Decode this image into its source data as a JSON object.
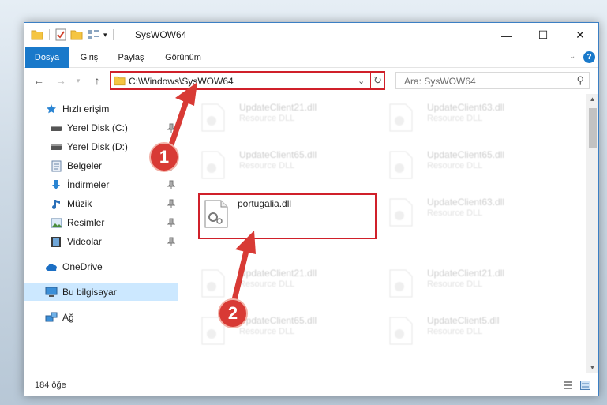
{
  "window": {
    "title": "SysWOW64",
    "minimize_glyph": "—",
    "maximize_glyph": "☐",
    "close_glyph": "✕"
  },
  "ribbon": {
    "tabs": [
      "Dosya",
      "Giriş",
      "Paylaş",
      "Görünüm"
    ]
  },
  "address": {
    "path": "C:\\Windows\\SysWOW64",
    "search_placeholder": "Ara: SysWOW64"
  },
  "nav": {
    "items": [
      {
        "label": "Hızlı erişim",
        "icon": "star-icon",
        "pinned": false
      },
      {
        "label": "Yerel Disk (C:)",
        "icon": "drive-icon",
        "pinned": true
      },
      {
        "label": "Yerel Disk (D:)",
        "icon": "drive-icon",
        "pinned": true
      },
      {
        "label": "Belgeler",
        "icon": "documents-icon",
        "pinned": true
      },
      {
        "label": "İndirmeler",
        "icon": "download-icon",
        "pinned": true
      },
      {
        "label": "Müzik",
        "icon": "music-icon",
        "pinned": true
      },
      {
        "label": "Resimler",
        "icon": "pictures-icon",
        "pinned": true
      },
      {
        "label": "Videolar",
        "icon": "video-icon",
        "pinned": true
      },
      {
        "label": "OneDrive",
        "icon": "cloud-icon",
        "pinned": false
      },
      {
        "label": "Bu bilgisayar",
        "icon": "computer-icon",
        "pinned": false,
        "selected": true
      },
      {
        "label": "Ağ",
        "icon": "network-icon",
        "pinned": false
      }
    ]
  },
  "files": {
    "focused": {
      "name": "portugalia.dll"
    },
    "background": [
      {
        "name": "UpdateClient21.dll",
        "type": "Resource DLL"
      },
      {
        "name": "UpdateClient63.dll",
        "type": "Resource DLL"
      },
      {
        "name": "UpdateClient65.dll",
        "type": "Resource DLL"
      },
      {
        "name": "UpdateClient65.dll",
        "type": "Resource DLL"
      },
      {
        "name": "UpdateClient63.dll",
        "type": "Resource DLL"
      },
      {
        "name": "UpdateClient21.dll",
        "type": "Resource DLL"
      },
      {
        "name": "UpdateClient21.dll",
        "type": "Resource DLL"
      },
      {
        "name": "UpdateClient65.dll",
        "type": "Resource DLL"
      },
      {
        "name": "UpdateClient5.dll",
        "type": "Resource DLL"
      }
    ]
  },
  "status": {
    "count": "184 öğe"
  },
  "callouts": [
    "1",
    "2"
  ],
  "colors": {
    "accent": "#1979ca",
    "highlight": "#d0202a",
    "callout": "#d83a35"
  }
}
